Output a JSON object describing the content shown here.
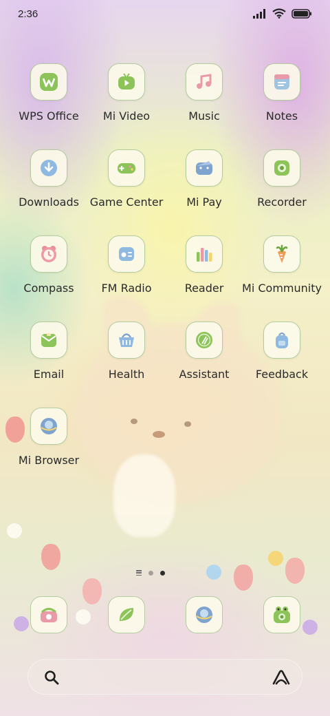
{
  "status_bar": {
    "time": "2:36",
    "battery_level": 1.0
  },
  "apps": [
    {
      "id": "wps-office",
      "label": "WPS Office",
      "icon": "wps-icon"
    },
    {
      "id": "mi-video",
      "label": "Mi Video",
      "icon": "tv-icon"
    },
    {
      "id": "music",
      "label": "Music",
      "icon": "music-note-icon"
    },
    {
      "id": "notes",
      "label": "Notes",
      "icon": "notes-icon"
    },
    {
      "id": "downloads",
      "label": "Downloads",
      "icon": "download-icon"
    },
    {
      "id": "game-center",
      "label": "Game Center",
      "icon": "gamepad-icon"
    },
    {
      "id": "mi-pay",
      "label": "Mi Pay",
      "icon": "wallet-icon"
    },
    {
      "id": "recorder",
      "label": "Recorder",
      "icon": "record-icon"
    },
    {
      "id": "compass",
      "label": "Compass",
      "icon": "clock-icon"
    },
    {
      "id": "fm-radio",
      "label": "FM Radio",
      "icon": "radio-icon"
    },
    {
      "id": "reader",
      "label": "Reader",
      "icon": "books-icon"
    },
    {
      "id": "mi-community",
      "label": "Mi Community",
      "icon": "carrot-icon"
    },
    {
      "id": "email",
      "label": "Email",
      "icon": "envelope-icon"
    },
    {
      "id": "health",
      "label": "Health",
      "icon": "basket-icon"
    },
    {
      "id": "assistant",
      "label": "Assistant",
      "icon": "assistant-orb-icon"
    },
    {
      "id": "feedback",
      "label": "Feedback",
      "icon": "backpack-icon"
    },
    {
      "id": "mi-browser",
      "label": "Mi Browser",
      "icon": "globe-icon"
    }
  ],
  "dock": [
    {
      "id": "phone",
      "icon": "telephone-icon"
    },
    {
      "id": "messages",
      "icon": "leaf-chat-icon"
    },
    {
      "id": "browser",
      "icon": "globe-icon"
    },
    {
      "id": "camera",
      "icon": "frog-camera-icon"
    }
  ],
  "page_indicator": {
    "pages": 2,
    "current": 2
  },
  "colors": {
    "tile_border": "#aac896",
    "tile_bg": "#fcfaea",
    "label": "#2a2a2a"
  }
}
